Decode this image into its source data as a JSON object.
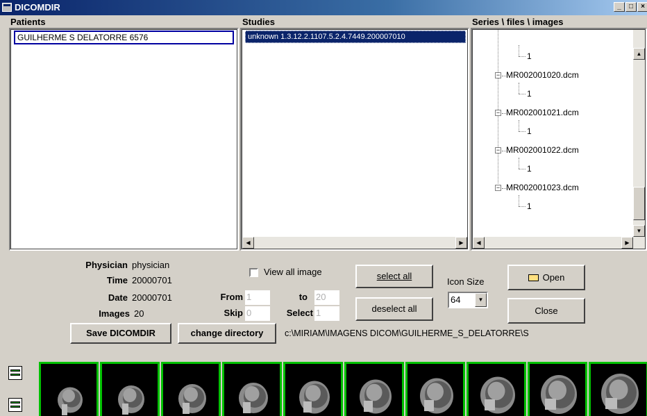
{
  "window": {
    "title": "DICOMDIR"
  },
  "titlebar": {
    "minimize": "_",
    "maximize": "□",
    "close": "×"
  },
  "panes": {
    "patients": {
      "header": "Patients",
      "items": [
        "GUILHERME S DELATORRE 6576"
      ]
    },
    "studies": {
      "header": "Studies",
      "items": [
        "unknown 1.3.12.2.1107.5.2.4.7449.200007010"
      ]
    },
    "series": {
      "header": "Series \\ files \\ images",
      "tree": [
        {
          "label": "1",
          "level": 2
        },
        {
          "label": "MR002001020.dcm",
          "level": 1
        },
        {
          "label": "1",
          "level": 2
        },
        {
          "label": "MR002001021.dcm",
          "level": 1
        },
        {
          "label": "1",
          "level": 2
        },
        {
          "label": "MR002001022.dcm",
          "level": 1
        },
        {
          "label": "1",
          "level": 2
        },
        {
          "label": "MR002001023.dcm",
          "level": 1
        },
        {
          "label": "1",
          "level": 2
        }
      ]
    }
  },
  "info": {
    "physician_label": "Physician",
    "physician_value": "physician",
    "time_label": "Time",
    "time_value": "20000701",
    "date_label": "Date",
    "date_value": "20000701",
    "images_label": "Images",
    "images_value": "20"
  },
  "range": {
    "view_all_label": "View all image",
    "from_label": "From",
    "from_value": "1",
    "to_label": "to",
    "to_value": "20",
    "skip_label": "Skip",
    "skip_value": "0",
    "select_label": "Select",
    "select_value": "1"
  },
  "buttons": {
    "select_all": "select all",
    "deselect_all": "deselect all",
    "open": "Open",
    "close": "Close",
    "save_dicomdir": "Save DICOMDIR",
    "change_directory": "change directory"
  },
  "icon_size": {
    "label": "Icon Size",
    "value": "64"
  },
  "path": "c:\\MIRIAM\\IMAGENS DICOM\\GUILHERME_S_DELATORRE\\S",
  "thumbnails": {
    "count": 10,
    "border_color": "#00c000"
  }
}
